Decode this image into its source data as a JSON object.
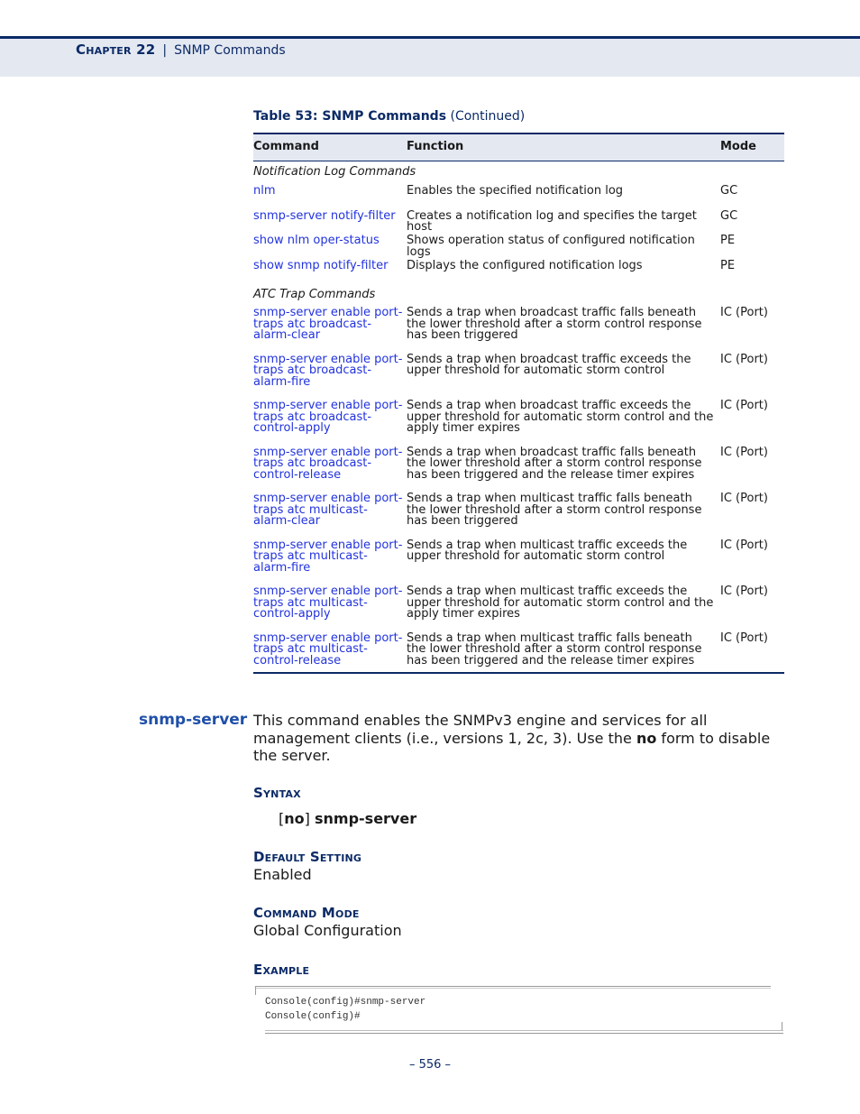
{
  "header": {
    "chapter_label": "Chapter 22",
    "separator": "|",
    "title": "SNMP Commands"
  },
  "table": {
    "caption_bold": "Table 53: SNMP Commands",
    "caption_suffix": " (Continued)",
    "columns": [
      "Command",
      "Function",
      "Mode"
    ],
    "sections": [
      {
        "title": "Notification Log Commands",
        "rows": [
          {
            "command": "nlm",
            "function": "Enables the specified notification log",
            "mode": "GC"
          },
          {
            "command": "snmp-server notify-filter",
            "function": "Creates a notification log and specifies the target host",
            "mode": "GC"
          },
          {
            "command": "show nlm oper-status",
            "function": "Shows operation status of configured notification logs",
            "mode": "PE"
          },
          {
            "command": "show snmp notify-filter",
            "function": "Displays the configured notification logs",
            "mode": "PE"
          }
        ]
      },
      {
        "title": "ATC Trap Commands",
        "rows": [
          {
            "command": "snmp-server enable port-traps atc broadcast-alarm-clear",
            "function": "Sends a trap when broadcast traffic falls beneath the lower threshold after a storm control response has been triggered",
            "mode": "IC (Port)"
          },
          {
            "command": "snmp-server enable port-traps atc broadcast-alarm-fire",
            "function": "Sends a trap when broadcast traffic exceeds the upper threshold for automatic storm control",
            "mode": "IC (Port)"
          },
          {
            "command": "snmp-server enable port-traps atc broadcast-control-apply",
            "function": "Sends a trap when broadcast traffic exceeds the upper threshold for automatic storm control and the apply timer expires",
            "mode": "IC (Port)"
          },
          {
            "command": "snmp-server enable port-traps atc broadcast-control-release",
            "function": "Sends a trap when broadcast traffic falls beneath the lower threshold after a storm control response has been triggered and the release timer expires",
            "mode": "IC (Port)"
          },
          {
            "command": "snmp-server enable port-traps atc multicast-alarm-clear",
            "function": "Sends a trap when multicast traffic falls beneath the lower threshold after a storm control response has been triggered",
            "mode": "IC (Port)"
          },
          {
            "command": "snmp-server enable port-traps atc multicast-alarm-fire",
            "function": "Sends a trap when multicast traffic exceeds the upper threshold for automatic storm control",
            "mode": "IC (Port)"
          },
          {
            "command": "snmp-server enable port-traps atc multicast-control-apply",
            "function": "Sends a trap when multicast traffic exceeds the upper threshold for automatic storm control and the apply timer expires",
            "mode": "IC (Port)"
          },
          {
            "command": "snmp-server enable port-traps atc multicast-control-release",
            "function": "Sends a trap when multicast traffic falls beneath the lower threshold after a storm control response has been triggered and the release timer expires",
            "mode": "IC (Port)"
          }
        ]
      }
    ]
  },
  "command_section": {
    "name": "snmp-server",
    "description_before": "This command enables the SNMPv3 engine and services for all management clients (i.e., versions 1, 2c, 3). Use the ",
    "description_bold": "no",
    "description_after": " form to disable the server.",
    "syntax_heading": "Syntax",
    "syntax_open_bracket": "[",
    "syntax_no": "no",
    "syntax_close_bracket": "]",
    "syntax_command": "snmp-server",
    "default_heading": "Default Setting",
    "default_value": "Enabled",
    "mode_heading": "Command Mode",
    "mode_value": "Global Configuration",
    "example_heading": "Example",
    "example_lines": [
      "Console(config)#snmp-server",
      "Console(config)#"
    ]
  },
  "footer": {
    "page_number": "–  556  –"
  }
}
